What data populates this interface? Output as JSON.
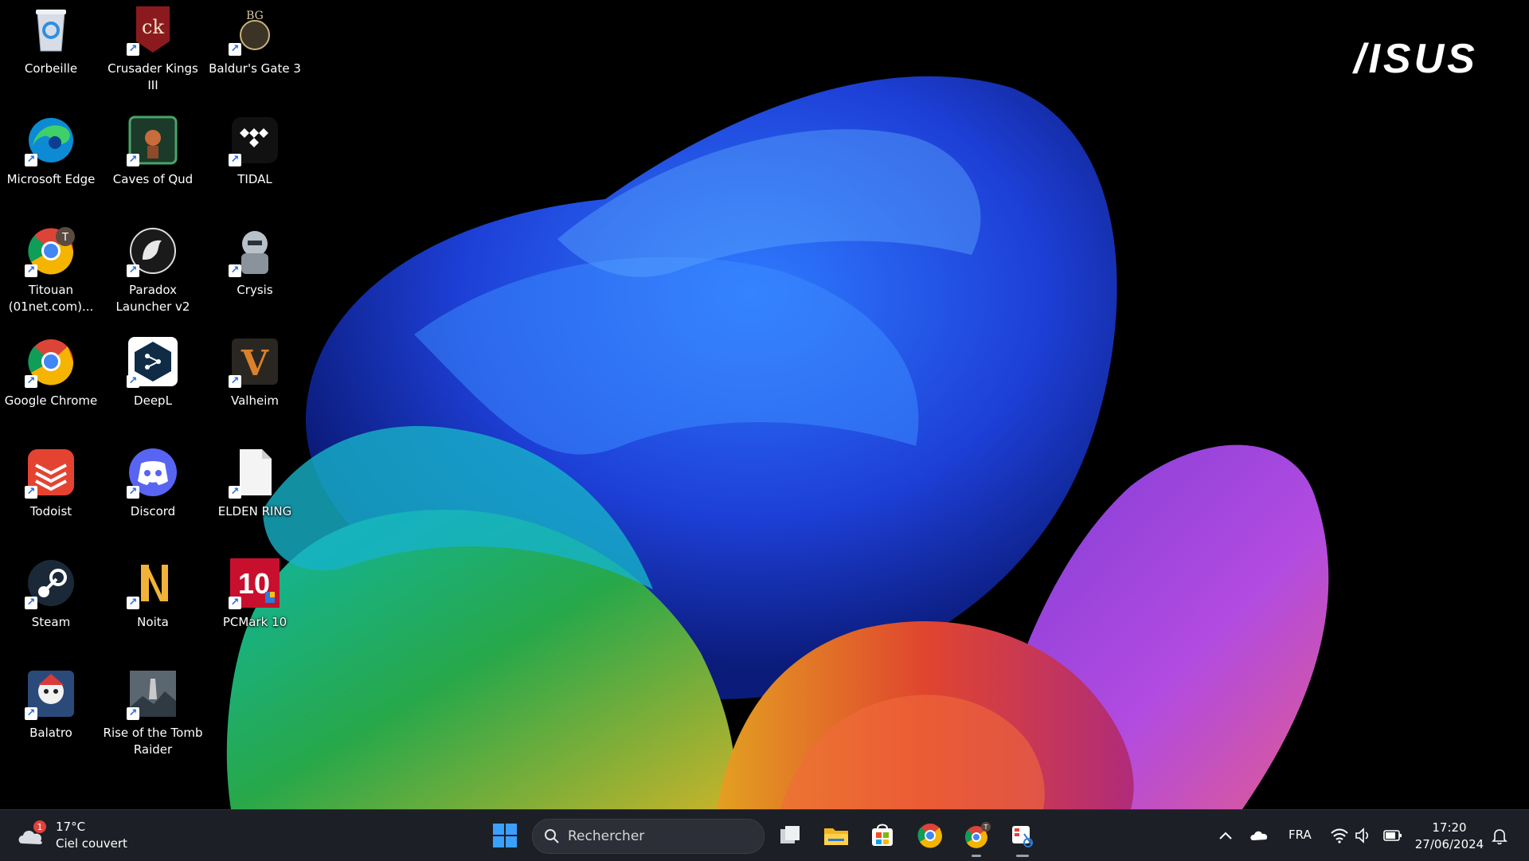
{
  "brand": {
    "logo_text": "/ISUS"
  },
  "desktop_icons": [
    {
      "id": "corbeille",
      "label": "Corbeille",
      "icon": "recycle-bin-icon"
    },
    {
      "id": "crusader-kings",
      "label": "Crusader Kings III",
      "icon": "crusader-kings-icon"
    },
    {
      "id": "baldurs-gate",
      "label": "Baldur's Gate 3",
      "icon": "baldurs-gate-icon"
    },
    {
      "id": "edge",
      "label": "Microsoft Edge",
      "icon": "edge-icon"
    },
    {
      "id": "caves-of-qud",
      "label": "Caves of Qud",
      "icon": "caves-of-qud-icon"
    },
    {
      "id": "tidal",
      "label": "TIDAL",
      "icon": "tidal-icon"
    },
    {
      "id": "chrome-titouan",
      "label": "Titouan (01net.com)...",
      "icon": "chrome-profile-icon",
      "badge": "T"
    },
    {
      "id": "paradox",
      "label": "Paradox Launcher v2",
      "icon": "paradox-icon"
    },
    {
      "id": "crysis",
      "label": "Crysis",
      "icon": "crysis-icon"
    },
    {
      "id": "chrome",
      "label": "Google Chrome",
      "icon": "chrome-icon"
    },
    {
      "id": "deepl",
      "label": "DeepL",
      "icon": "deepl-icon"
    },
    {
      "id": "valheim",
      "label": "Valheim",
      "icon": "valheim-icon"
    },
    {
      "id": "todoist",
      "label": "Todoist",
      "icon": "todoist-icon"
    },
    {
      "id": "discord",
      "label": "Discord",
      "icon": "discord-icon"
    },
    {
      "id": "elden-ring",
      "label": "ELDEN RING",
      "icon": "file-icon"
    },
    {
      "id": "steam",
      "label": "Steam",
      "icon": "steam-icon"
    },
    {
      "id": "noita",
      "label": "Noita",
      "icon": "noita-icon"
    },
    {
      "id": "pcmark",
      "label": "PCMark 10",
      "icon": "pcmark-icon"
    },
    {
      "id": "balatro",
      "label": "Balatro",
      "icon": "balatro-icon"
    },
    {
      "id": "tomb-raider",
      "label": "Rise of the Tomb Raider",
      "icon": "tomb-raider-icon"
    }
  ],
  "taskbar": {
    "weather": {
      "temp": "17°C",
      "condition": "Ciel couvert",
      "badge": "1"
    },
    "search": {
      "placeholder": "Rechercher"
    },
    "apps": [
      {
        "name": "task-view",
        "icon": "task-view-icon"
      },
      {
        "name": "file-explorer",
        "icon": "folder-icon"
      },
      {
        "name": "microsoft-store",
        "icon": "store-icon"
      },
      {
        "name": "chrome",
        "icon": "chrome-icon"
      },
      {
        "name": "chrome-profile",
        "icon": "chrome-profile-icon",
        "badge": "T"
      },
      {
        "name": "snipping-tool",
        "icon": "snipping-tool-icon"
      }
    ],
    "tray": {
      "language": "FRA"
    },
    "clock": {
      "time": "17:20",
      "date": "27/06/2024"
    }
  },
  "colors": {
    "taskbar_bg": "#1d1f26",
    "accent_blue": "#0078d4"
  }
}
